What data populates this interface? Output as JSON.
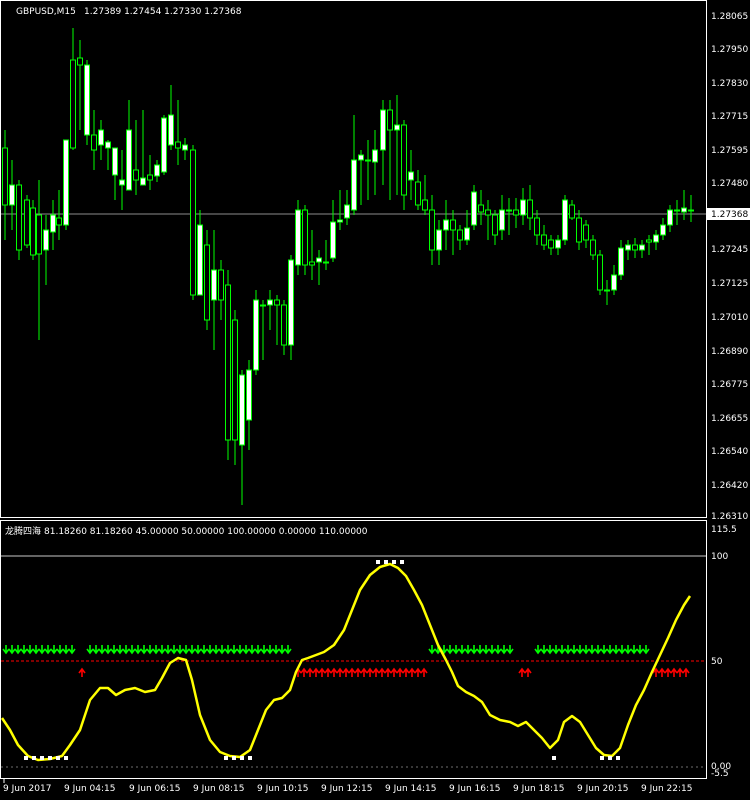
{
  "main_header": {
    "symbol": "GBPUSD,M15",
    "ohlc": "1.27389 1.27454 1.27330 1.27368"
  },
  "main_axis": {
    "labels": [
      "1.28065",
      "1.27950",
      "1.27830",
      "1.27715",
      "1.27595",
      "1.27480",
      "1.27245",
      "1.27125",
      "1.27010",
      "1.26890",
      "1.26775",
      "1.26655",
      "1.26540",
      "1.26420",
      "1.26310"
    ],
    "current_price": "1.27368"
  },
  "indicator_header": {
    "name": "龙腾四海",
    "values": "81.18260 81.18260 45.00000 50.00000 100.00000 0.00000 110.00000"
  },
  "indicator_axis": {
    "labels": [
      "115.5",
      "100",
      "50",
      "0.00",
      "-5.5"
    ]
  },
  "time_axis": {
    "labels": [
      "9 Jun 2017",
      "9 Jun 04:15",
      "9 Jun 06:15",
      "9 Jun 08:15",
      "9 Jun 10:15",
      "9 Jun 12:15",
      "9 Jun 14:15",
      "9 Jun 16:15",
      "9 Jun 18:15",
      "9 Jun 20:15",
      "9 Jun 22:15"
    ]
  },
  "colors": {
    "background": "#000000",
    "candle": "#00ff00",
    "bull_body": "#ffffff",
    "bear_body": "#000000",
    "indicator_line": "#ffff00",
    "level_50": "#ff0000",
    "level_100": "#ffffff",
    "green_arrows": "#00ff00",
    "red_arrows": "#ff0000",
    "dots": "#ffffff"
  },
  "icons": {
    "green_signal": "down-arrow-icon",
    "red_signal": "up-arrow-icon",
    "extreme_marker": "square-dot-icon"
  }
}
